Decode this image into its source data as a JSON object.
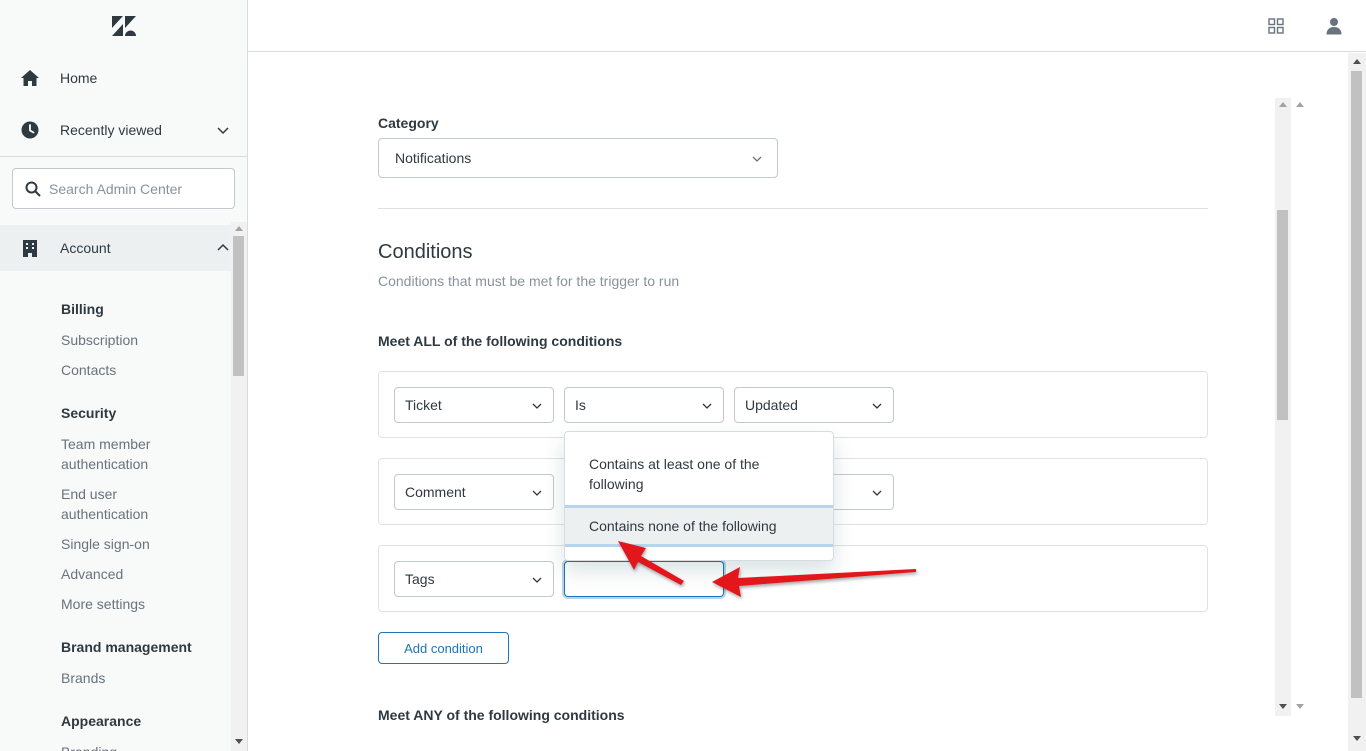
{
  "sidebar": {
    "logo": "zendesk-logo",
    "home_label": "Home",
    "recent_label": "Recently viewed",
    "search_placeholder": "Search Admin Center",
    "account_label": "Account",
    "sections": [
      {
        "heading": "Billing",
        "items": [
          "Subscription",
          "Contacts"
        ]
      },
      {
        "heading": "Security",
        "items": [
          "Team member authentication",
          "End user authentication",
          "Single sign-on",
          "Advanced",
          "More settings"
        ]
      },
      {
        "heading": "Brand management",
        "items": [
          "Brands"
        ]
      },
      {
        "heading": "Appearance",
        "items": [
          "Branding"
        ]
      }
    ]
  },
  "topbar": {
    "icons": [
      "products-grid-icon",
      "user-profile-icon"
    ]
  },
  "form": {
    "category_label": "Category",
    "category_value": "Notifications",
    "conditions_title": "Conditions",
    "conditions_hint": "Conditions that must be met for the trigger to run",
    "all_label": "Meet ALL of the following conditions",
    "rows": [
      {
        "field": "Ticket",
        "operator": "Is",
        "value": "Updated"
      },
      {
        "field": "Comment",
        "operator": "",
        "value": ""
      },
      {
        "field": "Tags",
        "operator": "",
        "value": ""
      }
    ],
    "add_condition": "Add condition",
    "any_label": "Meet ANY of the following conditions"
  },
  "dropdown": {
    "options": [
      "Contains at least one of the following",
      "Contains none of the following"
    ],
    "highlighted": "Contains none of the following"
  },
  "colors": {
    "accent": "#1f73b7",
    "annotation": "#e3171b"
  }
}
